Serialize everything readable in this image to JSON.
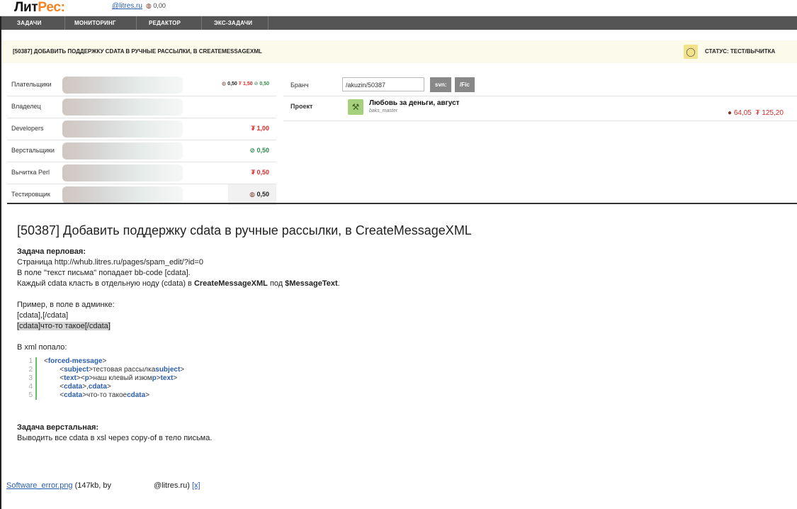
{
  "header": {
    "logo_main": "Лит",
    "logo_accent": "Рес:",
    "user_link": "@litres.ru",
    "balance": "0,00"
  },
  "nav": [
    "ЗАДАЧИ",
    "МОНИТОРИНГ",
    "РЕДАКТОР",
    "ЭКС-ЗАДАЧИ"
  ],
  "task": {
    "title": "[50387] ДОБАВИТЬ ПОДДЕРЖКУ CDATA В РУЧНЫЕ РАССЫЛКИ, В CREATEMESSAGEXML",
    "status": "СТАТУС: ТЕСТ/ВЫЧИТКА"
  },
  "people": {
    "payers": {
      "label": "Плательщики",
      "v1": "0,50",
      "v2": "1,50",
      "v3": "0,50"
    },
    "owner": {
      "label": "Владелец"
    },
    "developers": {
      "label": "Developers",
      "value": "1,00"
    },
    "layout": {
      "label": "Верстальщики",
      "value": "0,50"
    },
    "perl": {
      "label": "Вычитка Perl",
      "value": "0,50"
    },
    "tester": {
      "label": "Тестировщик",
      "value": "0,50"
    }
  },
  "branch": {
    "label": "Бранч",
    "value": "/akuzin/50387",
    "svn": "svn:",
    "fic": "/Fic"
  },
  "project": {
    "label": "Проект",
    "name": "Любовь за деньги, август",
    "owner": "baks_master",
    "v1": "64,05",
    "v2": "125,20"
  },
  "description": {
    "heading": "[50387] Добавить поддержку cdata в ручные рассылки, в CreateMessageXML",
    "sec1_title": "Задача перловая:",
    "line1": "Страница http://whub.litres.ru/pages/spam_edit/?id=0",
    "line2": "В поле \"текст письма\" попадает bb-code [cdata].",
    "line3_pre": "Каждый cdata класть в отдельную ноду (cdata) в ",
    "line3_b1": "CreateMessageXML",
    "line3_mid": " под ",
    "line3_b2": "$MessageText",
    "line3_end": ".",
    "example_intro": "Пример, в поле в админке:",
    "example1": "[cdata],[/cdata]",
    "example2": "[cdata]что-то такое[/cdata]",
    "xml_intro": "В xml попало:",
    "code_lines": {
      "l1_tag": "forced-message",
      "l2_tag": "subject",
      "l2_text": "тестовая рассылка",
      "l2_close": "subject",
      "l3_tag": "text",
      "l3_p": "p",
      "l3_text": "наш клевый изюм",
      "l3_p2": "p",
      "l3_close": "text",
      "l4_tag": "cdata",
      "l4_close": "cdata",
      "l5_tag": "cdata",
      "l5_text": "что-то такое",
      "l5_close": "cdata"
    },
    "sec2_title": "Задача верстальная:",
    "sec2_line": "Выводить все cdata в xsl через copy-of в тело письма."
  },
  "attachment": {
    "file": "Software_error.png",
    "meta": " (147kb, by",
    "author": "@litres.ru)",
    "remove": "[x]"
  }
}
